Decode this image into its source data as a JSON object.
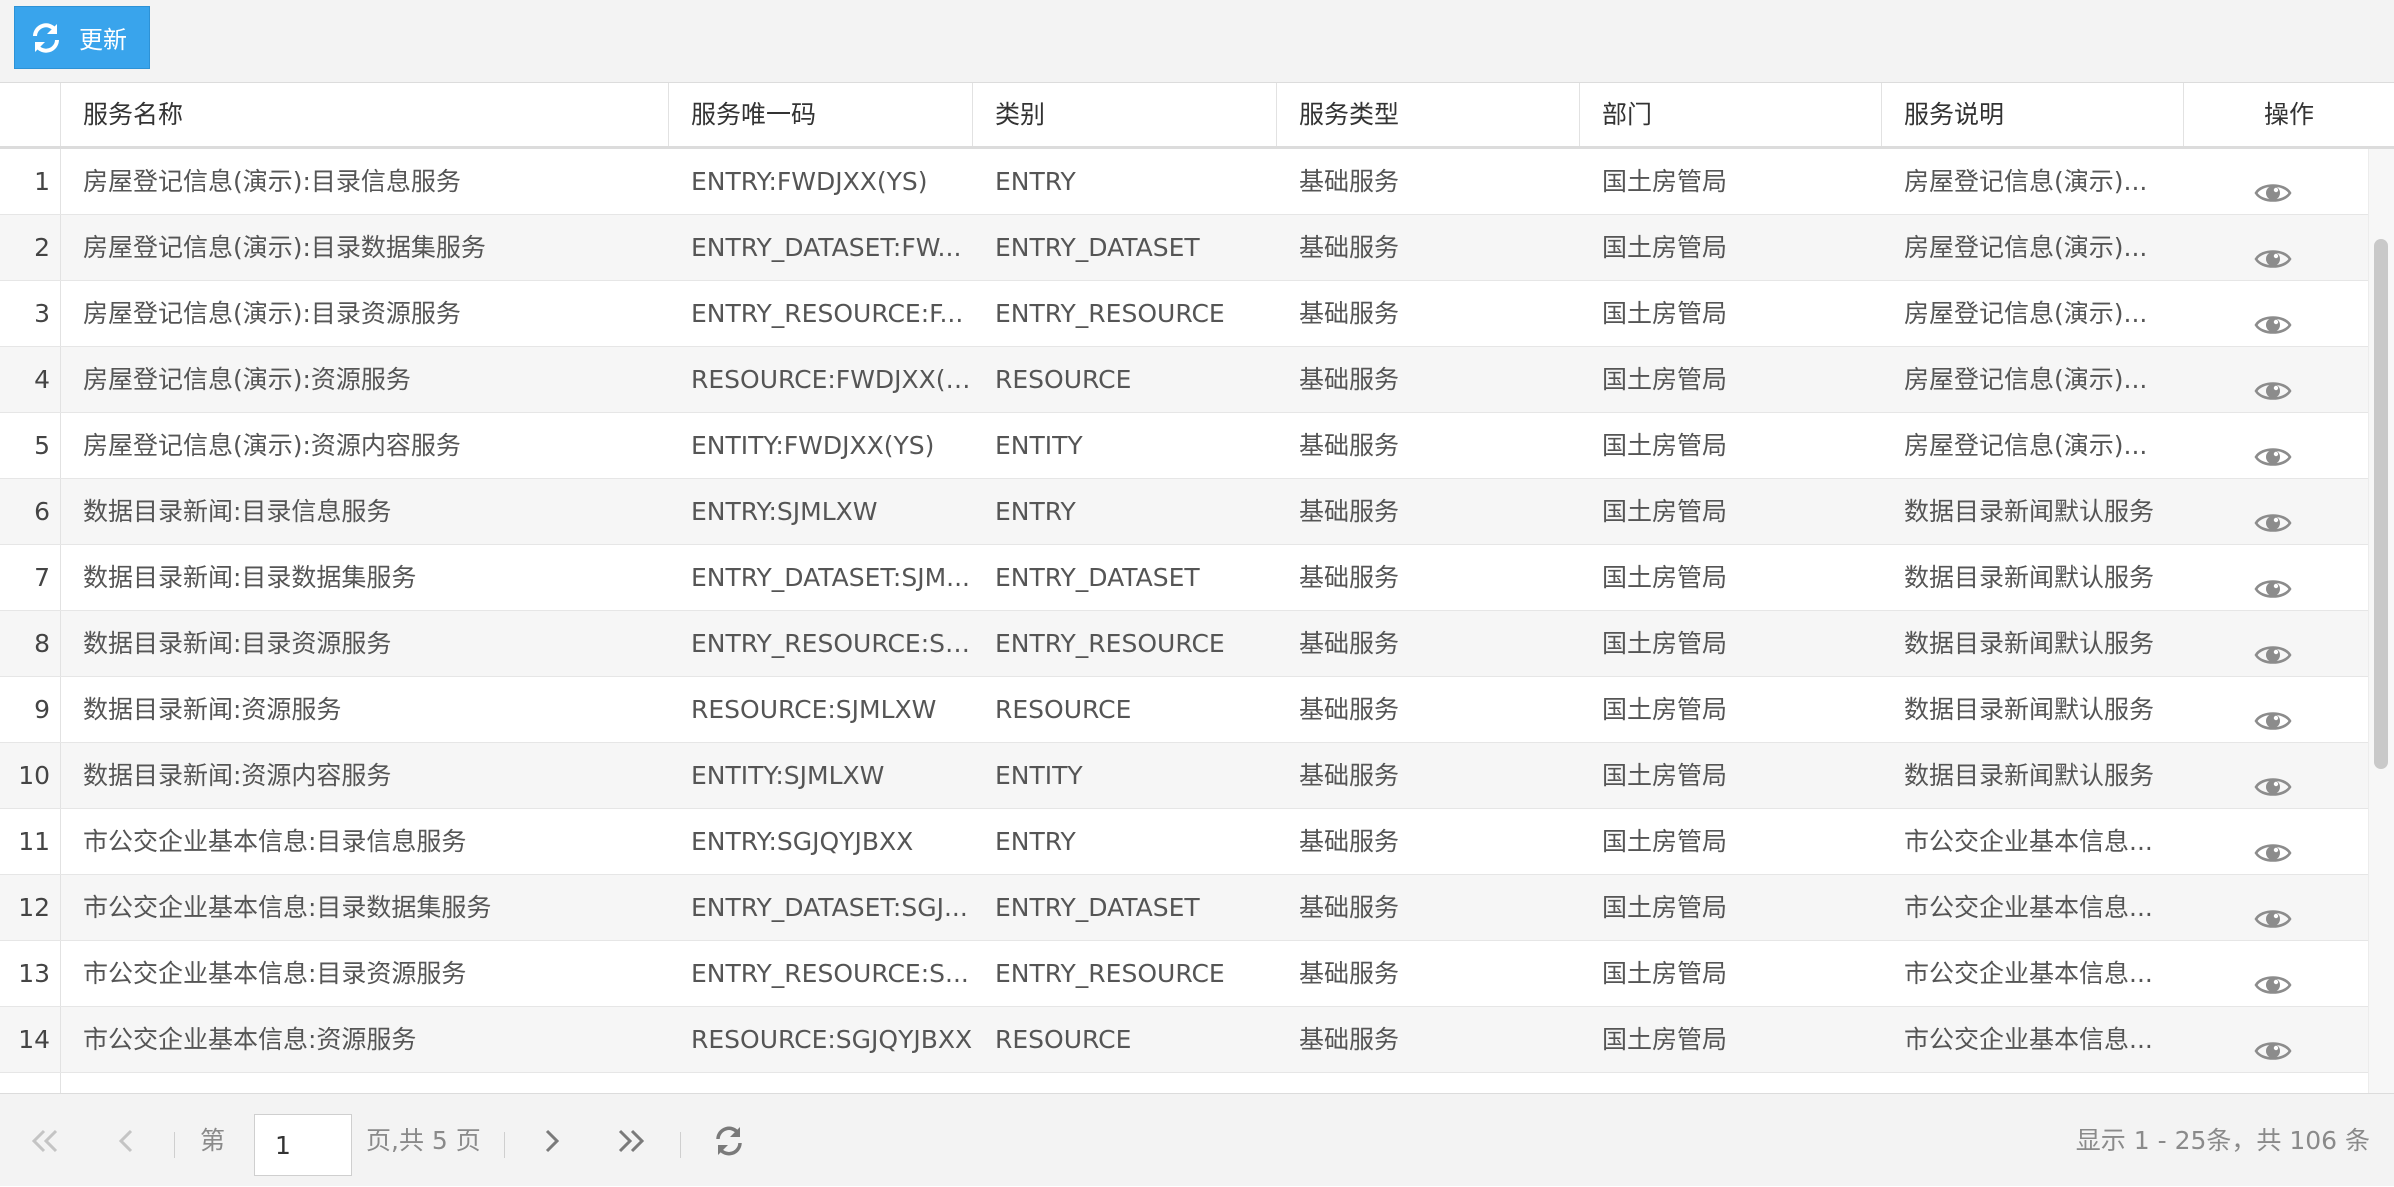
{
  "toolbar": {
    "refresh_label": "更新"
  },
  "grid": {
    "columns": [
      "服务名称",
      "服务唯一码",
      "类别",
      "服务类型",
      "部门",
      "服务说明",
      "操作"
    ],
    "rows": [
      {
        "n": "1",
        "name": "房屋登记信息(演示):目录信息服务",
        "code": "ENTRY:FWDJXX(YS)",
        "cat": "ENTRY",
        "type": "基础服务",
        "dept": "国土房管局",
        "desc": "房屋登记信息(演示)..."
      },
      {
        "n": "2",
        "name": "房屋登记信息(演示):目录数据集服务",
        "code": "ENTRY_DATASET:FW...",
        "cat": "ENTRY_DATASET",
        "type": "基础服务",
        "dept": "国土房管局",
        "desc": "房屋登记信息(演示)..."
      },
      {
        "n": "3",
        "name": "房屋登记信息(演示):目录资源服务",
        "code": "ENTRY_RESOURCE:F...",
        "cat": "ENTRY_RESOURCE",
        "type": "基础服务",
        "dept": "国土房管局",
        "desc": "房屋登记信息(演示)..."
      },
      {
        "n": "4",
        "name": "房屋登记信息(演示):资源服务",
        "code": "RESOURCE:FWDJXX(Y...",
        "cat": "RESOURCE",
        "type": "基础服务",
        "dept": "国土房管局",
        "desc": "房屋登记信息(演示)..."
      },
      {
        "n": "5",
        "name": "房屋登记信息(演示):资源内容服务",
        "code": "ENTITY:FWDJXX(YS)",
        "cat": "ENTITY",
        "type": "基础服务",
        "dept": "国土房管局",
        "desc": "房屋登记信息(演示)..."
      },
      {
        "n": "6",
        "name": "数据目录新闻:目录信息服务",
        "code": "ENTRY:SJMLXW",
        "cat": "ENTRY",
        "type": "基础服务",
        "dept": "国土房管局",
        "desc": "数据目录新闻默认服务"
      },
      {
        "n": "7",
        "name": "数据目录新闻:目录数据集服务",
        "code": "ENTRY_DATASET:SJM...",
        "cat": "ENTRY_DATASET",
        "type": "基础服务",
        "dept": "国土房管局",
        "desc": "数据目录新闻默认服务"
      },
      {
        "n": "8",
        "name": "数据目录新闻:目录资源服务",
        "code": "ENTRY_RESOURCE:SJ...",
        "cat": "ENTRY_RESOURCE",
        "type": "基础服务",
        "dept": "国土房管局",
        "desc": "数据目录新闻默认服务"
      },
      {
        "n": "9",
        "name": "数据目录新闻:资源服务",
        "code": "RESOURCE:SJMLXW",
        "cat": "RESOURCE",
        "type": "基础服务",
        "dept": "国土房管局",
        "desc": "数据目录新闻默认服务"
      },
      {
        "n": "10",
        "name": "数据目录新闻:资源内容服务",
        "code": "ENTITY:SJMLXW",
        "cat": "ENTITY",
        "type": "基础服务",
        "dept": "国土房管局",
        "desc": "数据目录新闻默认服务"
      },
      {
        "n": "11",
        "name": "市公交企业基本信息:目录信息服务",
        "code": "ENTRY:SGJQYJBXX",
        "cat": "ENTRY",
        "type": "基础服务",
        "dept": "国土房管局",
        "desc": "市公交企业基本信息..."
      },
      {
        "n": "12",
        "name": "市公交企业基本信息:目录数据集服务",
        "code": "ENTRY_DATASET:SGJ...",
        "cat": "ENTRY_DATASET",
        "type": "基础服务",
        "dept": "国土房管局",
        "desc": "市公交企业基本信息..."
      },
      {
        "n": "13",
        "name": "市公交企业基本信息:目录资源服务",
        "code": "ENTRY_RESOURCE:S...",
        "cat": "ENTRY_RESOURCE",
        "type": "基础服务",
        "dept": "国土房管局",
        "desc": "市公交企业基本信息..."
      },
      {
        "n": "14",
        "name": "市公交企业基本信息:资源服务",
        "code": "RESOURCE:SGJQYJBXX",
        "cat": "RESOURCE",
        "type": "基础服务",
        "dept": "国土房管局",
        "desc": "市公交企业基本信息..."
      },
      {
        "n": "",
        "name": "",
        "code": "",
        "cat": "",
        "type": "",
        "dept": "",
        "desc": ""
      }
    ]
  },
  "pager": {
    "page_prefix": "第",
    "page_value": "1",
    "page_suffix": "页,共 5 页",
    "display_info": "显示 1 - 25条，共 106 条"
  },
  "icons": {
    "refresh": "refresh-icon",
    "view": "eye-icon",
    "first": "double-chevron-left-icon",
    "prev": "chevron-left-icon",
    "next": "chevron-right-icon",
    "last": "double-chevron-right-icon",
    "reload": "reload-icon"
  },
  "colors": {
    "accent": "#39a4ec"
  }
}
